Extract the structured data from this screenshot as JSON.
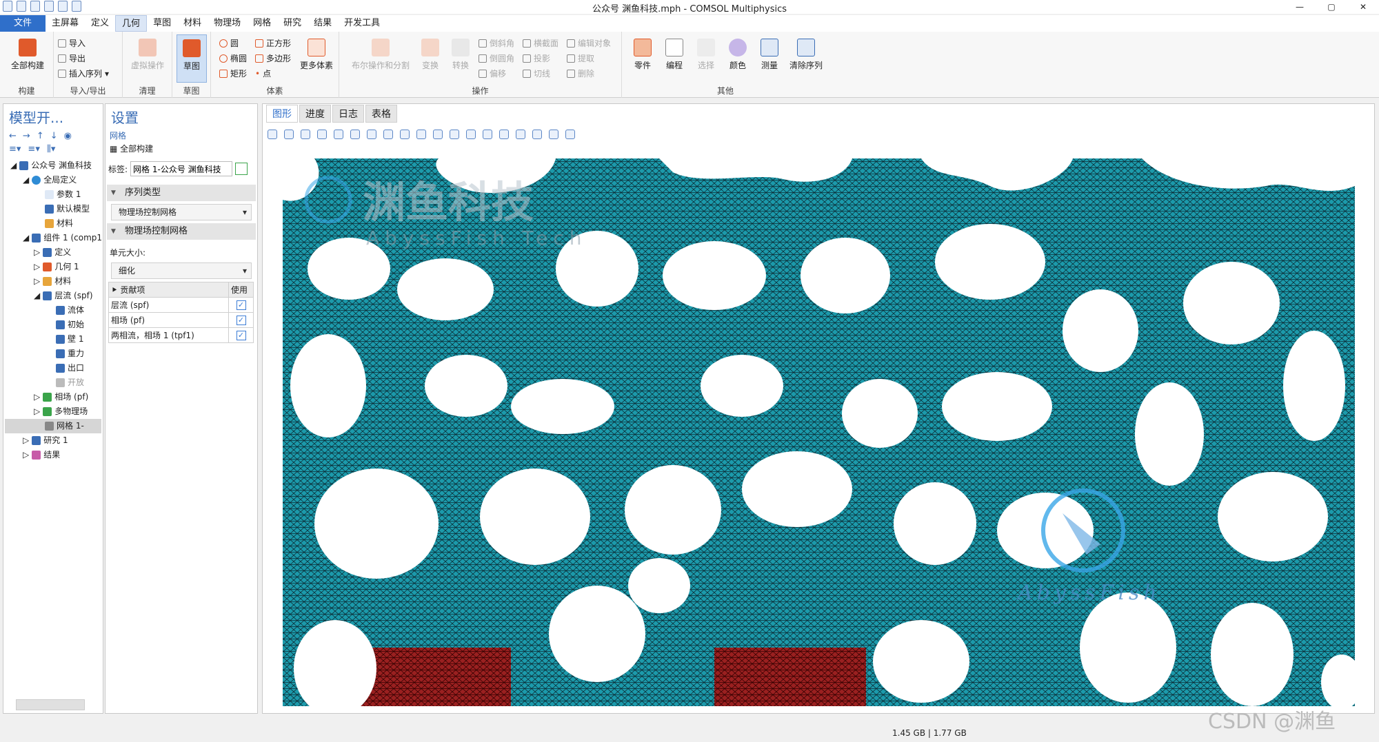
{
  "window": {
    "title": "公众号 渊鱼科技.mph - COMSOL Multiphysics",
    "controls": [
      "—",
      "▢",
      "✕"
    ]
  },
  "menubar": {
    "items": [
      "文件",
      "主屏幕",
      "定义",
      "几何",
      "草图",
      "材料",
      "物理场",
      "网格",
      "研究",
      "结果",
      "开发工具"
    ]
  },
  "ribbon": {
    "build": {
      "big": "全部构建",
      "group": "构建"
    },
    "importexport": {
      "import": "导入",
      "export": "导出",
      "insert": "插入序列",
      "group": "导入/导出"
    },
    "cleanup": {
      "virtual": "虚拟操作",
      "group": "清理"
    },
    "sketch": {
      "big": "草图",
      "group": "草图"
    },
    "primitives": {
      "circle": "圆",
      "ellipse": "椭圆",
      "rect": "矩形",
      "square": "正方形",
      "polygon": "多边形",
      "point": "点",
      "more": "更多体素",
      "group": "体素"
    },
    "operations": {
      "bool": "布尔操作和分割",
      "transform": "变换",
      "convert": "转换",
      "chamfer": "倒斜角",
      "fillet": "倒圆角",
      "offset": "偏移",
      "crosssection": "横截面",
      "projection": "投影",
      "tangent": "切线",
      "editobj": "编辑对象",
      "extract": "提取",
      "delete": "删除",
      "group": "操作"
    },
    "other": {
      "parts": "零件",
      "program": "编程",
      "select": "选择",
      "color": "颜色",
      "measure": "测量",
      "clear": "清除序列",
      "group": "其他"
    }
  },
  "modelbuilder": {
    "title": "模型开...",
    "tree": [
      "公众号 渊鱼科技",
      "全局定义",
      "参数 1",
      "默认模型",
      "材料",
      "组件 1 (comp1)",
      "定义",
      "几何 1",
      "材料",
      "层流 (spf)",
      "流体",
      "初始",
      "壁 1",
      "重力",
      "出口",
      "开放",
      "相场 (pf)",
      "多物理场",
      "网格 1-",
      "研究 1",
      "结果"
    ]
  },
  "settings": {
    "title": "设置",
    "subtitle": "网格",
    "build_all": "全部构建",
    "label_caption": "标签:",
    "label_value": "网格 1-公众号 渊鱼科技",
    "seq_section": "序列类型",
    "seq_value": "物理场控制网格",
    "phys_section": "物理场控制网格",
    "size_caption": "单元大小:",
    "size_value": "细化",
    "contrib": {
      "h1": "贡献项",
      "h2": "使用",
      "rows": [
        "层流 (spf)",
        "相场 (pf)",
        "两相流，相场 1 (tpf1)"
      ]
    }
  },
  "graphics": {
    "tabs": [
      "图形",
      "进度",
      "日志",
      "表格"
    ],
    "watermark1": "渊鱼科技",
    "watermark2": "AbyssFish Tech",
    "watermark3": "AbyssFish"
  },
  "status": {
    "memory": "1.45 GB | 1.77 GB",
    "csdn": "CSDN @渊鱼"
  },
  "colors": {
    "mesh": "#29b3c4",
    "inlet": "#8f1d1d",
    "accent": "#2f6fca"
  }
}
